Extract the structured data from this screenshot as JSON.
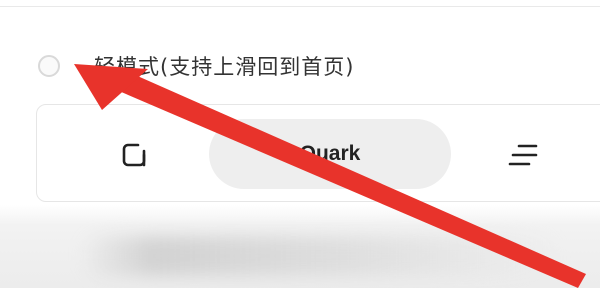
{
  "option": {
    "label": "轻模式(支持上滑回到首页)",
    "selected": false
  },
  "toolbar_preview": {
    "address_label": "Quark",
    "left_icon": "tabs-icon",
    "right_icon": "menu-lines-icon"
  },
  "annotation": {
    "arrow_color": "#e8332b",
    "arrow_target": "option-radio"
  },
  "colors": {
    "background": "#f3f3f3",
    "card": "#ffffff",
    "pill": "#eeeeee",
    "text": "#333333"
  }
}
